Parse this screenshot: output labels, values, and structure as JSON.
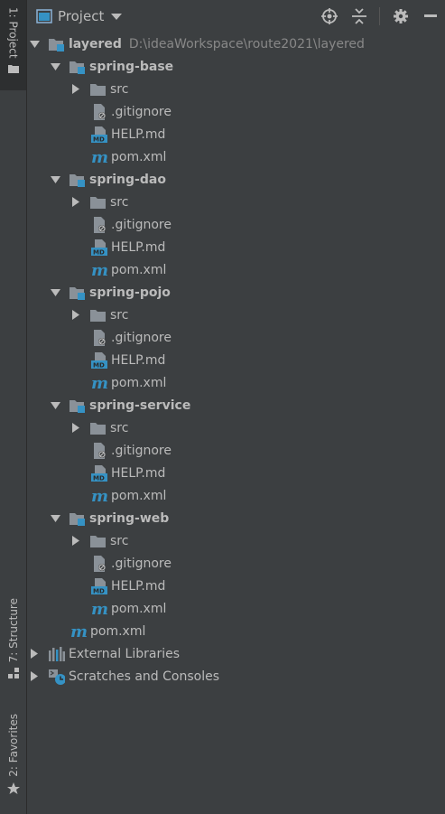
{
  "header": {
    "title": "Project"
  },
  "stripe": {
    "project": "1: Project",
    "structure": "7: Structure",
    "favorites": "2: Favorites"
  },
  "root": {
    "name": "layered",
    "path": "D:\\ideaWorkspace\\route2021\\layered"
  },
  "modules": [
    {
      "name": "spring-base",
      "src": "src",
      "gitignore": ".gitignore",
      "help": "HELP.md",
      "pom": "pom.xml"
    },
    {
      "name": "spring-dao",
      "src": "src",
      "gitignore": ".gitignore",
      "help": "HELP.md",
      "pom": "pom.xml"
    },
    {
      "name": "spring-pojo",
      "src": "src",
      "gitignore": ".gitignore",
      "help": "HELP.md",
      "pom": "pom.xml"
    },
    {
      "name": "spring-service",
      "src": "src",
      "gitignore": ".gitignore",
      "help": "HELP.md",
      "pom": "pom.xml"
    },
    {
      "name": "spring-web",
      "src": "src",
      "gitignore": ".gitignore",
      "help": "HELP.md",
      "pom": "pom.xml"
    }
  ],
  "root_pom": "pom.xml",
  "external_libraries": "External Libraries",
  "scratches": "Scratches and Consoles",
  "colors": {
    "background": "#3c3f41",
    "text": "#bbbbbb",
    "path": "#888888",
    "folder": "#8a9198",
    "module_accent": "#3592c4",
    "maven": "#3592c4"
  }
}
